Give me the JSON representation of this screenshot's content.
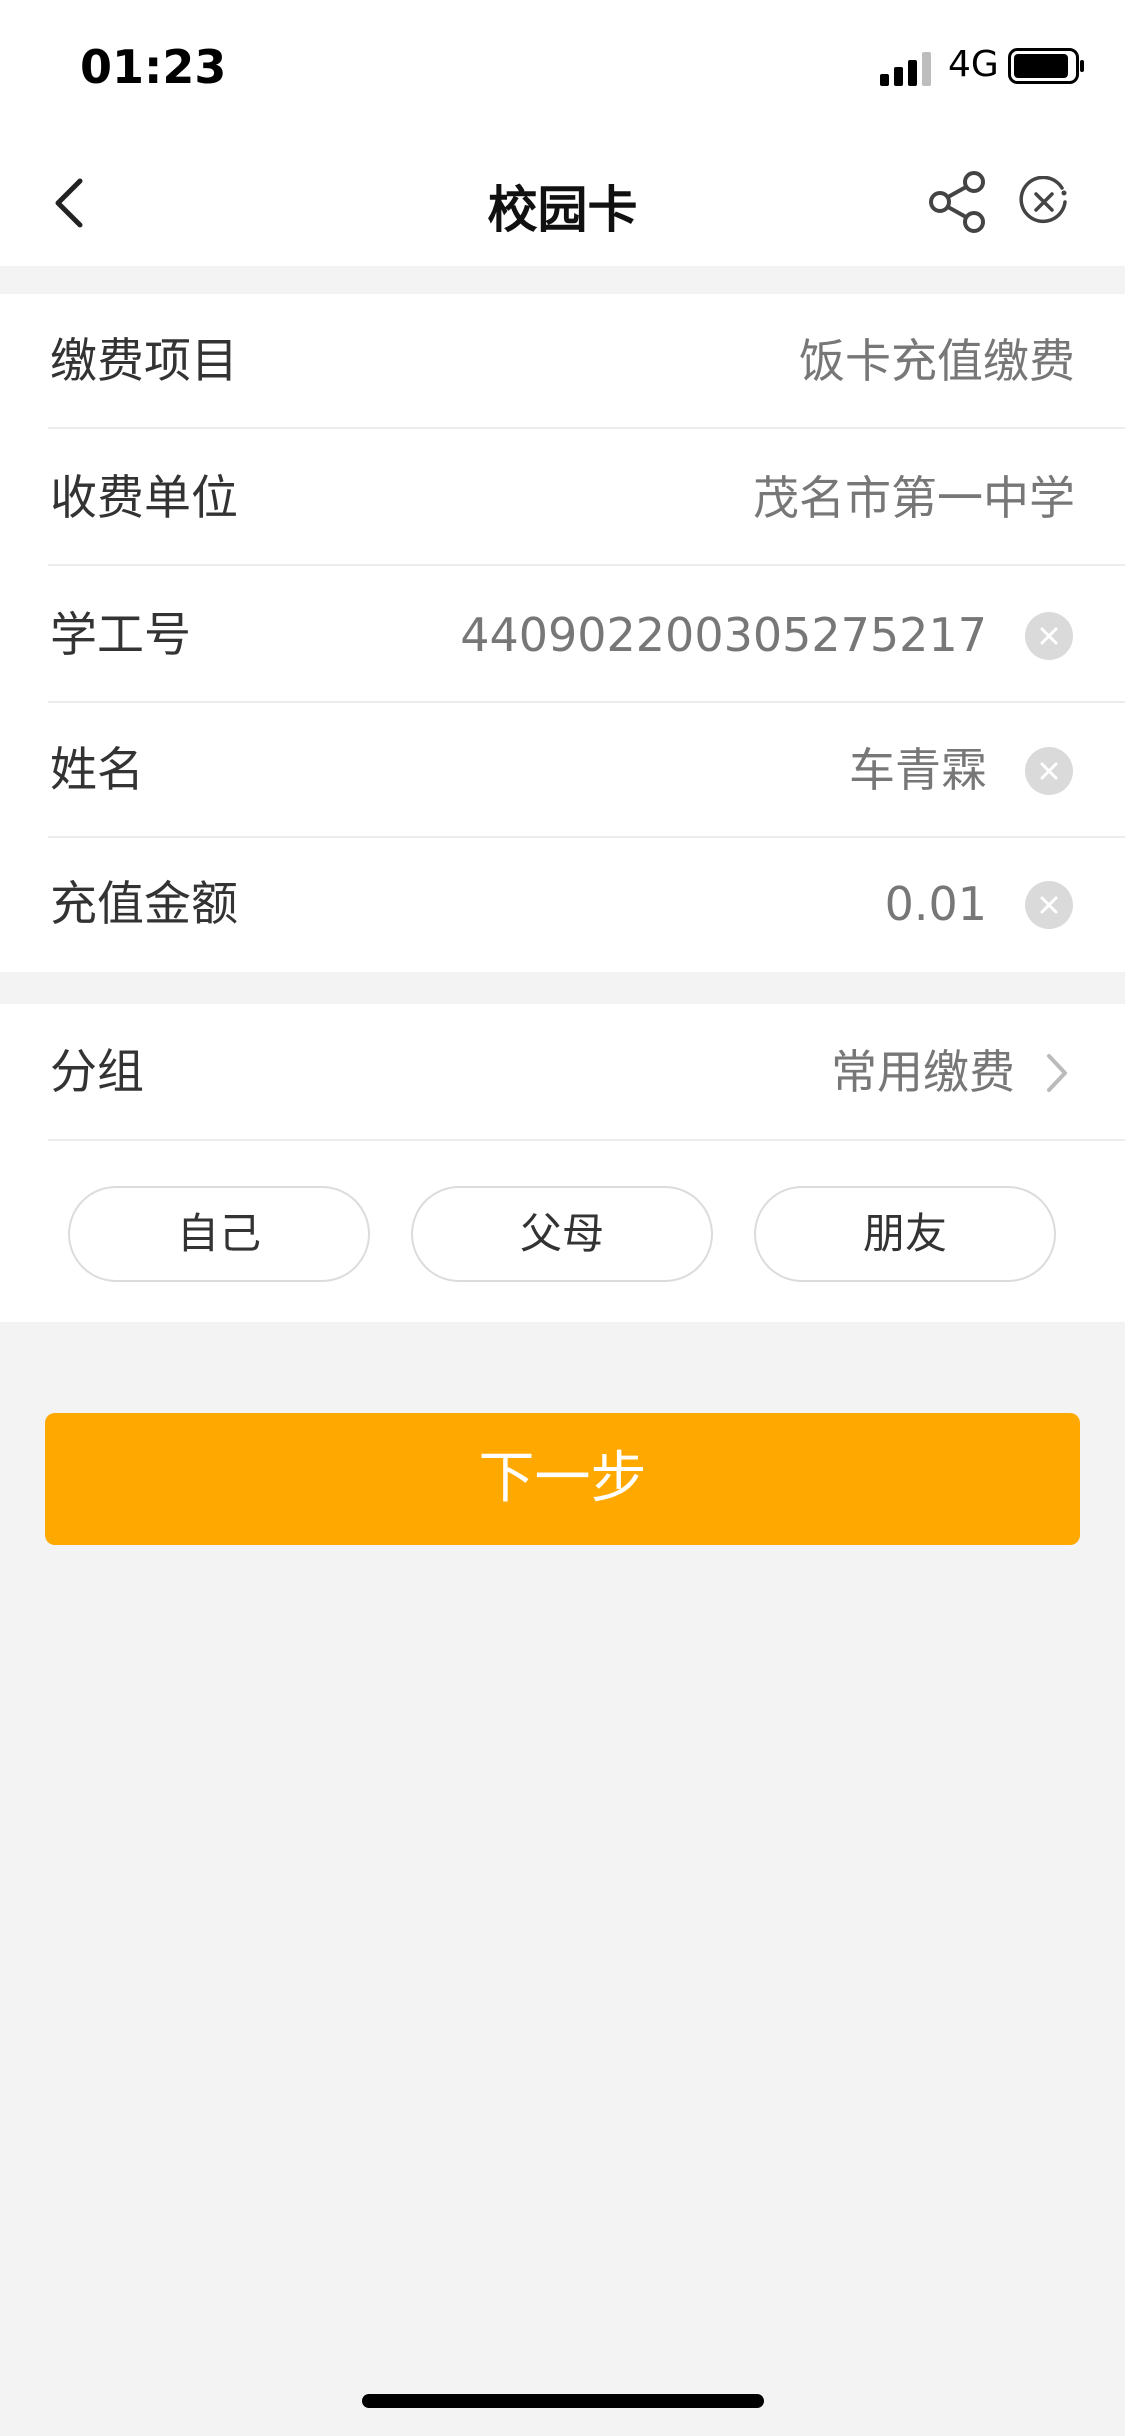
{
  "status_bar": {
    "time": "01:23",
    "network": "4G"
  },
  "nav": {
    "title": "校园卡",
    "back_icon": "chevron-left-icon",
    "share_icon": "share-icon",
    "close_icon": "close-circle-icon"
  },
  "form": {
    "rows": [
      {
        "label": "缴费项目",
        "value": "饭卡充值缴费"
      },
      {
        "label": "收费单位",
        "value": "茂名市第一中学"
      },
      {
        "label": "学工号",
        "value": "440902200305275217"
      },
      {
        "label": "姓名",
        "value": "车青霖"
      },
      {
        "label": "充值金额",
        "value": "0.01"
      }
    ]
  },
  "group": {
    "label": "分组",
    "value": "常用缴费",
    "chips": [
      "自己",
      "父母",
      "朋友"
    ]
  },
  "next_button": {
    "label": "下一步"
  },
  "colors": {
    "accent": "#ffa800",
    "background": "#f3f3f3"
  }
}
